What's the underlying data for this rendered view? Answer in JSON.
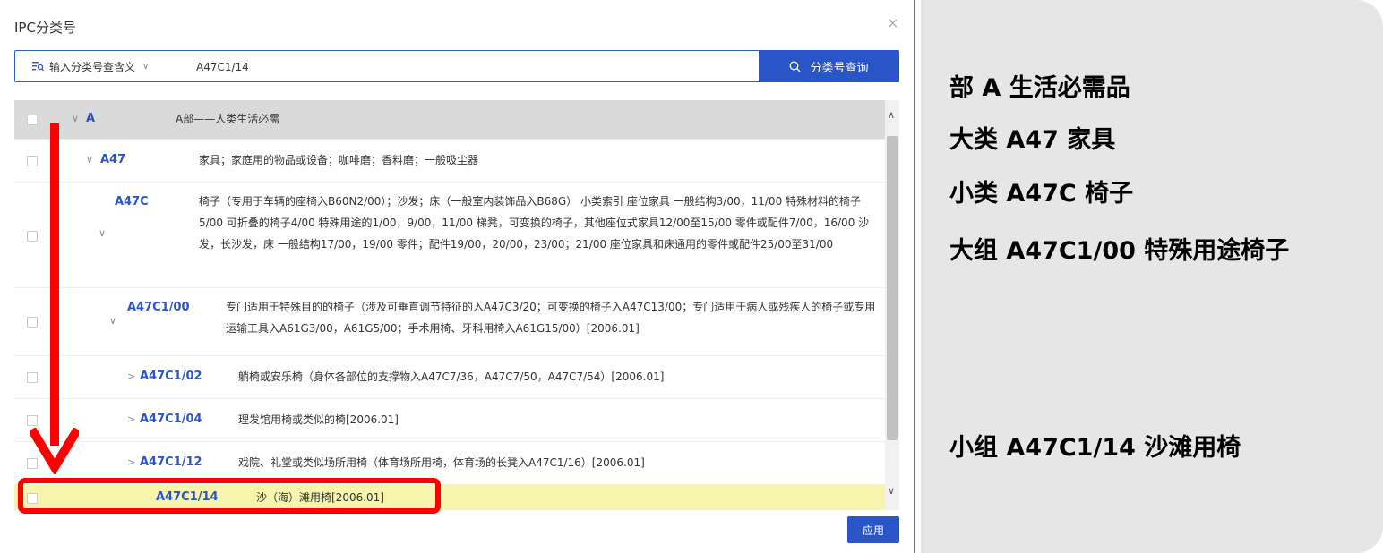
{
  "dialog": {
    "title": "IPC分类号",
    "close": "×"
  },
  "search": {
    "mode_label": "输入分类号查含义",
    "value": "A47C1/14",
    "button_label": "分类号查询"
  },
  "rows": [
    {
      "code": "A",
      "desc": "A部——人类生活必需",
      "expander": "∨"
    },
    {
      "code": "A47",
      "desc": "家具；家庭用的物品或设备；咖啡磨；香料磨；一般吸尘器",
      "expander": "∨"
    },
    {
      "code": "A47C",
      "desc": "椅子（专用于车辆的座椅入B60N2/00）；沙发；床（一般室内装饰品入B68G）  小类索引 座位家具 一般结构3/00，11/00 特殊材料的椅子5/00 可折叠的椅子4/00 特殊用途的1/00，9/00，11/00 梯凳，可变换的椅子，其他座位式家具12/00至15/00 零件或配件7/00，16/00 沙发，长沙发，床 一般结构17/00，19/00 零件；配件19/00，20/00，23/00；21/00 座位家具和床通用的零件或配件25/00至31/00",
      "expander": "∨"
    },
    {
      "code": "A47C1/00",
      "desc": "专门适用于特殊目的的椅子（涉及可垂直调节特征的入A47C3/20；可变换的椅子入A47C13/00；专门适用于病人或残疾人的椅子或专用运输工具入A61G3/00，A61G5/00；手术用椅、牙科用椅入A61G15/00）[2006.01]",
      "expander": "∨"
    },
    {
      "code": "A47C1/02",
      "desc": "躺椅或安乐椅（身体各部位的支撑物入A47C7/36，A47C7/50，A47C7/54）[2006.01]",
      "expander": ">"
    },
    {
      "code": "A47C1/04",
      "desc": "理发馆用椅或类似的椅[2006.01]",
      "expander": ">"
    },
    {
      "code": "A47C1/12",
      "desc": "戏院、礼堂或类似场所用椅（体育场所用椅，体育场的长凳入A47C1/16）[2006.01]",
      "expander": ">"
    },
    {
      "code": "A47C1/14",
      "desc": "沙（海）滩用椅[2006.01]",
      "expander": ""
    }
  ],
  "apply_label": "应用",
  "side_panel": {
    "section": "部    A 生活必需品",
    "class": "大类  A47 家具",
    "subclass": "小类  A47C 椅子",
    "main_group": "大组  A47C1/00 特殊用途椅子",
    "subgroup": "小组  A47C1/14  沙滩用椅"
  },
  "colors": {
    "accent": "#2a55c8",
    "highlight_row": "#f6f4ad",
    "annotation": "#ff0000",
    "panel_bg": "#e6e6e6"
  }
}
